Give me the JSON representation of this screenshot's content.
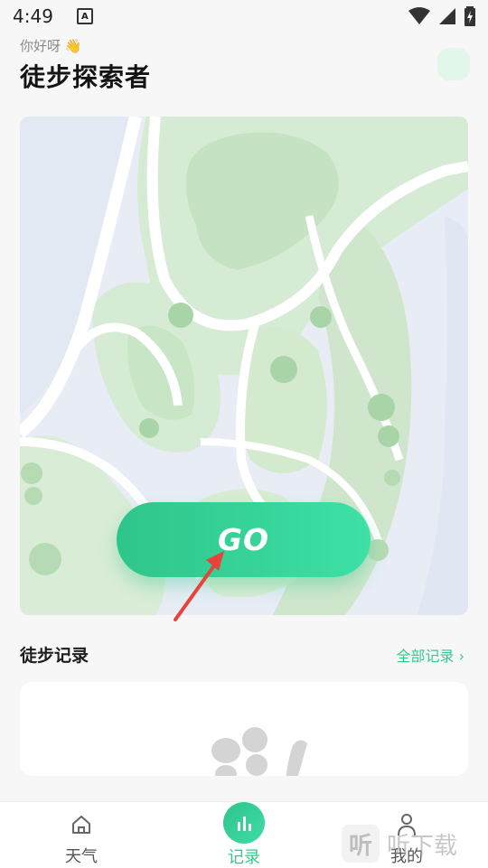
{
  "status": {
    "time": "4:49",
    "notification_icon": "a-icon"
  },
  "header": {
    "greeting": "你好呀 👋",
    "title": "徒步探索者"
  },
  "map": {
    "go_label": "GO"
  },
  "records": {
    "section_title": "徒步记录",
    "all_link": "全部记录 ›"
  },
  "tabs": [
    {
      "label": "天气",
      "icon": "home-icon"
    },
    {
      "label": "记录",
      "icon": "bar-chart-icon",
      "active": true
    },
    {
      "label": "我的",
      "icon": "person-icon"
    }
  ],
  "watermark": {
    "glyph": "听",
    "text": "听下载"
  },
  "colors": {
    "accent": "#34c98f",
    "map_green": "#cfe8cf",
    "map_blue": "#e6ecf5"
  }
}
